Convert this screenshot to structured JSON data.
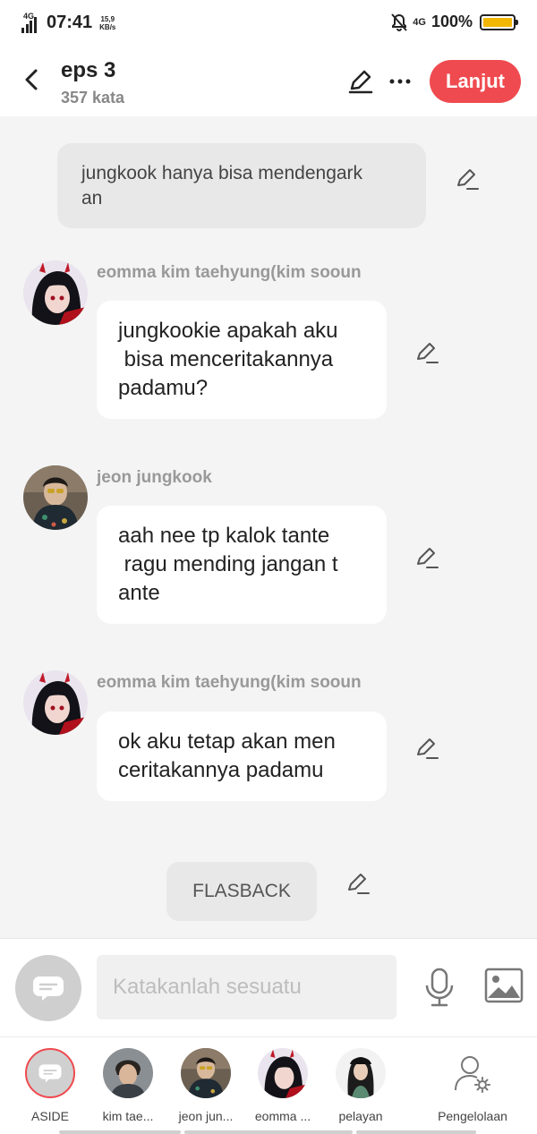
{
  "status_bar": {
    "network_label": "4G",
    "time": "07:41",
    "speed_value": "15,9",
    "speed_unit": "KB/s",
    "network_right": "4G",
    "battery_percent": "100%",
    "battery_level": 1.0
  },
  "header": {
    "title": "eps 3",
    "subtitle": "357 kata",
    "next_button": "Lanjut",
    "icons": [
      "back-arrow-icon",
      "pencil-icon",
      "more-icon"
    ]
  },
  "messages": [
    {
      "type": "narration",
      "text": "jungkook hanya bisa mendengark\nan"
    },
    {
      "type": "chat",
      "speaker": "eomma kim taehyung(kim sooun",
      "text": "jungkookie apakah aku\n bisa menceritakannya\npadamu?"
    },
    {
      "type": "chat",
      "speaker": "jeon jungkook",
      "text": "aah nee tp kalok tante\n ragu mending jangan t\nante"
    },
    {
      "type": "chat",
      "speaker": "eomma kim taehyung(kim sooun",
      "text": "ok aku tetap akan men\nceritakannya padamu"
    },
    {
      "type": "label",
      "text": "FLASBACK"
    }
  ],
  "input": {
    "placeholder": "Katakanlah sesuatu",
    "icons": [
      "chat-mode-icon",
      "microphone-icon",
      "image-icon"
    ]
  },
  "characters": [
    {
      "name": "ASIDE",
      "selected": true
    },
    {
      "name": "kim tae..."
    },
    {
      "name": "jeon jun..."
    },
    {
      "name": "eomma ..."
    },
    {
      "name": "pelayan"
    },
    {
      "name": "Pengelolaan"
    }
  ],
  "colors": {
    "accent": "#ef4a4f",
    "background": "#f4f4f4",
    "battery": "#f2b705"
  }
}
